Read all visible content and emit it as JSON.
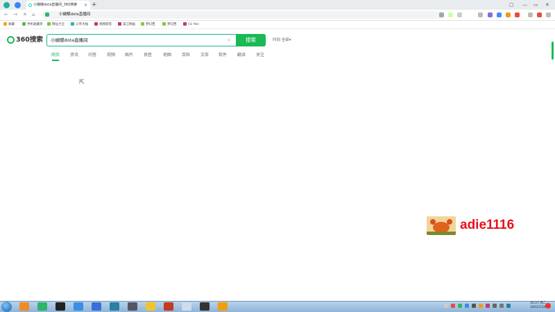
{
  "browser": {
    "tab_title": "小蝴蝶dota直播间_360搜索",
    "tab_close": "×",
    "new_tab": "+",
    "window_controls": [
      "▢",
      "—",
      "▭",
      "✕"
    ],
    "nav": {
      "back": "←",
      "forward": "→",
      "stop": "✕",
      "home": "⌂"
    },
    "url": "小蝴蝶dota直播间"
  },
  "bookmarks": [
    {
      "label": "收藏",
      "color": "#f5a623"
    },
    {
      "label": "手机收藏夹",
      "color": "#6ab04c"
    },
    {
      "label": "网址大全",
      "color": "#7ec242"
    },
    {
      "label": "斗罗大陆",
      "color": "#2fb3a5"
    },
    {
      "label": "视频影院",
      "color": "#c03a7a"
    },
    {
      "label": "美江映画",
      "color": "#c03a7a"
    },
    {
      "label": "梦幻西",
      "color": "#8bc34a"
    },
    {
      "label": "梦幻西",
      "color": "#8bc34a"
    },
    {
      "label": "(1) Yes-",
      "color": "#c03a7a"
    }
  ],
  "search": {
    "logo_text": "360搜索",
    "query": "小蝴蝶dota直播间",
    "clear": "×",
    "button_label": "搜索",
    "time_filter": "时间 全部▾"
  },
  "tabs": [
    {
      "label": "网页",
      "active": true
    },
    {
      "label": "资讯",
      "active": false
    },
    {
      "label": "问答",
      "active": false
    },
    {
      "label": "视频",
      "active": false
    },
    {
      "label": "图片",
      "active": false
    },
    {
      "label": "良医",
      "active": false
    },
    {
      "label": "地图",
      "active": false
    },
    {
      "label": "百科",
      "active": false
    },
    {
      "label": "文库",
      "active": false
    },
    {
      "label": "软件",
      "active": false
    },
    {
      "label": "翻译",
      "active": false
    },
    {
      "label": "关注",
      "active": false
    }
  ],
  "watermark": {
    "text": "adie1116"
  },
  "taskbar": {
    "time": "16:27 周二",
    "date": "2022/11/8"
  },
  "colors": {
    "accent": "#19b955",
    "watermark": "#e8101a"
  }
}
